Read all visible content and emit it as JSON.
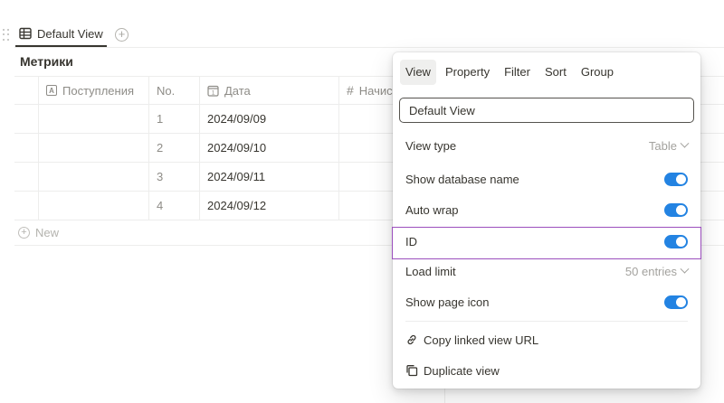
{
  "tabs": [
    {
      "label": "Default View",
      "icon": "table-icon",
      "active": true
    }
  ],
  "database": {
    "title": "Метрики",
    "columns": [
      {
        "label": "",
        "icon": ""
      },
      {
        "label": "Поступления",
        "icon": "text-property-icon"
      },
      {
        "label": "No.",
        "icon": ""
      },
      {
        "label": "Дата",
        "icon": "calendar-icon"
      },
      {
        "label": "Начис",
        "icon": "number-icon"
      }
    ],
    "rows": [
      {
        "no": "1",
        "date": "2024/09/09"
      },
      {
        "no": "2",
        "date": "2024/09/10"
      },
      {
        "no": "3",
        "date": "2024/09/11"
      },
      {
        "no": "4",
        "date": "2024/09/12"
      }
    ],
    "new_label": "New"
  },
  "popover": {
    "tabs": [
      "View",
      "Property",
      "Filter",
      "Sort",
      "Group"
    ],
    "active_tab": "View",
    "view_name": "Default View",
    "view_type": {
      "label": "View type",
      "value": "Table"
    },
    "show_database_name": {
      "label": "Show database name",
      "on": true
    },
    "auto_wrap": {
      "label": "Auto wrap",
      "on": true
    },
    "id_toggle": {
      "label": "ID",
      "on": true
    },
    "load_limit": {
      "label": "Load limit",
      "value": "50 entries"
    },
    "show_page_icon": {
      "label": "Show page icon",
      "on": true
    },
    "copy_link": {
      "label": "Copy linked view URL",
      "icon": "link-icon"
    },
    "duplicate": {
      "label": "Duplicate view",
      "icon": "duplicate-icon"
    }
  },
  "colors": {
    "accent": "#2383e2",
    "highlight": "#9b4fbd",
    "text": "#37352f",
    "muted": "#8e8c87"
  }
}
